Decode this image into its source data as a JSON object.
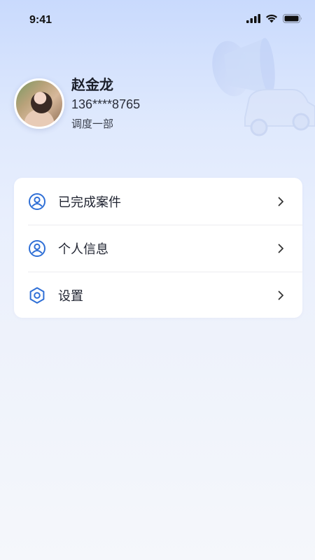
{
  "status_bar": {
    "time": "9:41",
    "icons": [
      "signal-icon",
      "wifi-icon",
      "battery-icon"
    ]
  },
  "profile": {
    "name": "赵金龙",
    "phone": "136****8765",
    "department": "调度一部"
  },
  "menu": {
    "items": [
      {
        "label": "已完成案件",
        "icon": "user-circle-icon"
      },
      {
        "label": "个人信息",
        "icon": "user-circle-icon"
      },
      {
        "label": "设置",
        "icon": "hexagon-settings-icon"
      }
    ]
  },
  "colors": {
    "accent": "#2f6fd6",
    "background_top": "#c9dafd",
    "background_bottom": "#f5f7fb",
    "card": "#ffffff"
  }
}
